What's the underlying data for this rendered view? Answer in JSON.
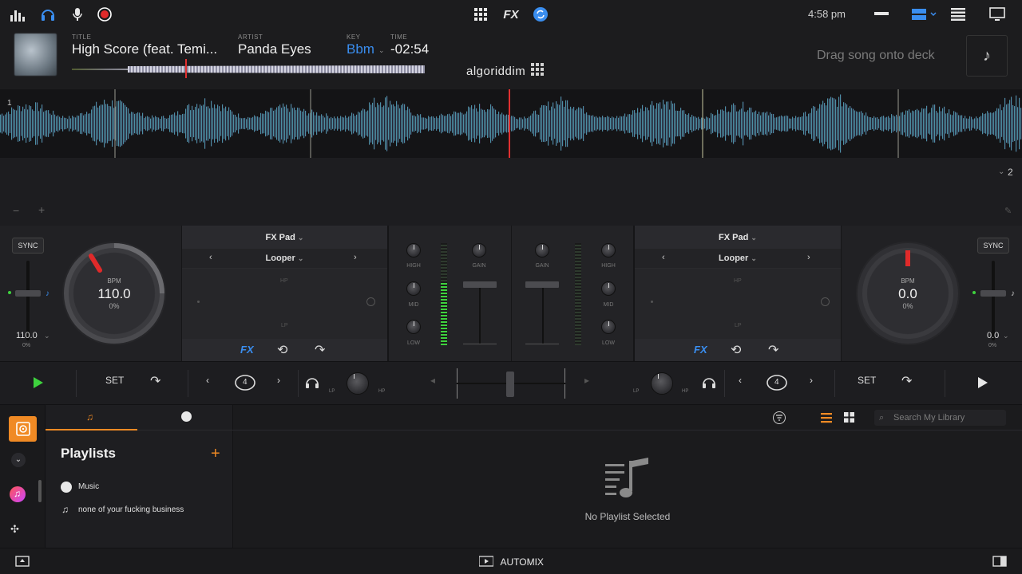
{
  "topbar": {
    "icons": [
      "equalizer-icon",
      "headphones-icon",
      "microphone-icon",
      "record-icon",
      "grid-icon",
      "fx-label",
      "sync-icon",
      "minus-bar-icon",
      "layout-icon",
      "menu-icon",
      "display-icon"
    ],
    "fx_label": "FX",
    "clock": "4:58 pm"
  },
  "track": {
    "title_label": "TITLE",
    "title": "High Score (feat. Temi...",
    "artist_label": "ARTIST",
    "artist": "Panda Eyes",
    "key_label": "KEY",
    "key": "Bbm",
    "time_label": "TIME",
    "time": "-02:54",
    "logo": "algoriddim",
    "drag_hint": "Drag song onto deck"
  },
  "waveform": {
    "deck1_number": "1",
    "deck2_number": "2",
    "zoom_minus": "−",
    "zoom_plus": "+"
  },
  "deck_left": {
    "sync": "SYNC",
    "bpm_label": "BPM",
    "bpm": "110.0",
    "pitch_pct": "0%",
    "pitch_value": "110.0",
    "pitch_value_pct": "0%",
    "panel_title": "FX Pad",
    "fx_mode": "Looper",
    "pad_top": "HP",
    "pad_bottom": "LP",
    "fx_btn": "FX"
  },
  "deck_right": {
    "sync": "SYNC",
    "bpm_label": "BPM",
    "bpm": "0.0",
    "pitch_pct": "0%",
    "pitch_value": "0.0",
    "pitch_value_pct": "0%",
    "panel_title": "FX Pad",
    "fx_mode": "Looper",
    "pad_top": "HP",
    "pad_bottom": "LP",
    "fx_btn": "FX"
  },
  "mixer": {
    "high": "HIGH",
    "mid": "MID",
    "low": "LOW",
    "gain": "GAIN"
  },
  "transport": {
    "set_left": "SET",
    "set_right": "SET",
    "loop_left": "4",
    "loop_right": "4",
    "lp": "LP",
    "hp": "HP"
  },
  "library": {
    "playlists_heading": "Playlists",
    "items": [
      {
        "icon": "apple-music-icon",
        "label": "Music"
      },
      {
        "icon": "playlist-icon",
        "label": "none of your fucking business"
      }
    ],
    "search_placeholder": "Search My Library",
    "empty_state": "No Playlist Selected"
  },
  "bottom": {
    "automix": "AUTOMIX"
  },
  "colors": {
    "accent_blue": "#3a8ef0",
    "accent_orange": "#f08a24",
    "meter_green": "#3ed23e",
    "marker_red": "#e03030"
  }
}
